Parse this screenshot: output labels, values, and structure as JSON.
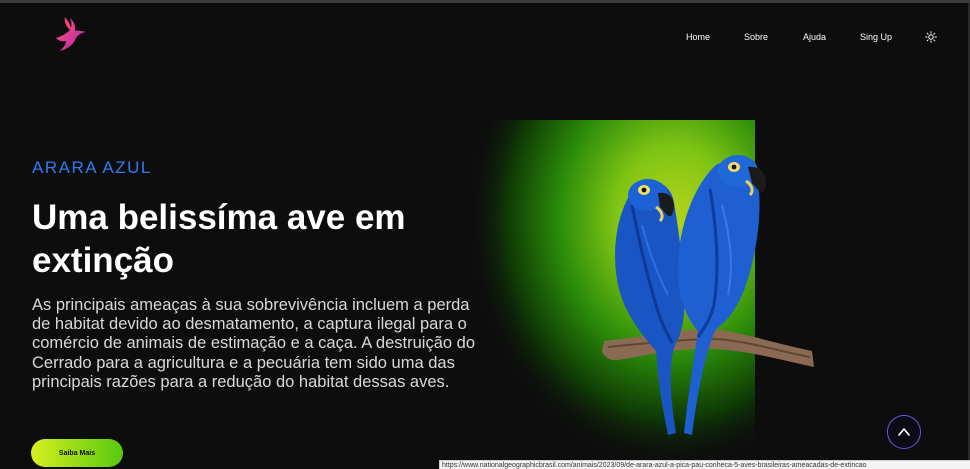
{
  "header": {
    "logo_icon": "hummingbird-logo-icon",
    "nav": [
      {
        "label": "Home"
      },
      {
        "label": "Sobre"
      },
      {
        "label": "Ajuda"
      },
      {
        "label": "Sing Up"
      }
    ],
    "theme_toggle_icon": "sun-icon"
  },
  "hero": {
    "eyebrow": "ARARA AZUL",
    "headline": "Uma belissíma ave em extinção",
    "body": "As principais ameaças à sua sobrevivência incluem a perda de habitat devido ao desmatamento, a captura ilegal para o comércio de animais de estimação e a caça. A destruição do Cerrado para a agricultura e a pecuária tem sido uma das principais razões para a redução do habitat dessas aves.",
    "cta_label": "Saiba Mais",
    "image_icon": "blue-macaw-pair-image"
  },
  "scroll_top_icon": "chevron-up-icon",
  "status_bar": {
    "url": "https://www.nationalgeographicbrasil.com/animais/2023/09/de-arara-azul-a-pica-pau-conheca-5-aves-brasileiras-ameacadas-de-extincao"
  },
  "colors": {
    "background": "#0d0d0d",
    "eyebrow": "#2f7df2",
    "cta_gradient_start": "#d6ef1f",
    "cta_gradient_end": "#58c80e",
    "glow_core": "#a9d31a",
    "glow_outer": "#1e7d08",
    "scroll_button_border": "#6c53f0"
  }
}
